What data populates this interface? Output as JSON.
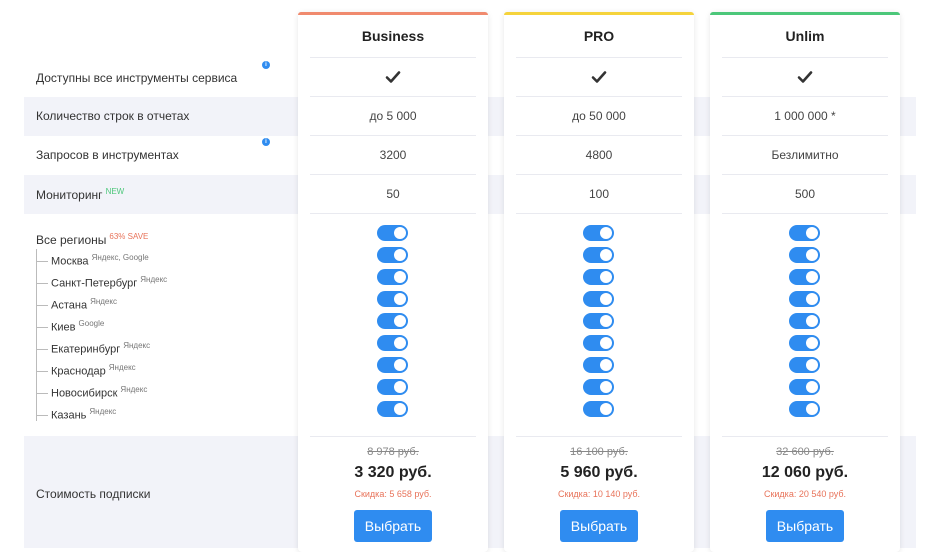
{
  "plans": [
    {
      "name": "Business",
      "accent": "#f08a6e",
      "lines": "до 5 000",
      "requests": "3200",
      "monitoring": "50",
      "old_price": "8 978 руб.",
      "price": "3 320 руб.",
      "discount": "Скидка: 5 658 руб.",
      "button": "Выбрать"
    },
    {
      "name": "PRO",
      "accent": "#f5d33c",
      "lines": "до 50 000",
      "requests": "4800",
      "monitoring": "100",
      "old_price": "16 100 руб.",
      "price": "5 960 руб.",
      "discount": "Скидка: 10 140 руб.",
      "button": "Выбрать"
    },
    {
      "name": "Unlim",
      "accent": "#4cc77a",
      "lines": "1 000 000 *",
      "requests": "Безлимитно",
      "monitoring": "500",
      "old_price": "32 600 руб.",
      "price": "12 060 руб.",
      "discount": "Скидка: 20 540 руб.",
      "button": "Выбрать"
    }
  ],
  "features": {
    "all_tools": "Доступны все инструменты сервиса",
    "lines": "Количество строк в отчетах",
    "requests": "Запросов в инструментах",
    "monitoring": "Мониторинг",
    "monitoring_badge": "NEW",
    "regions": "Все регионы",
    "regions_badge": "63% SAVE",
    "price": "Стоимость подписки"
  },
  "regions": [
    {
      "name": "Москва",
      "src": "Яндекс, Google"
    },
    {
      "name": "Санкт-Петербург",
      "src": "Яндекс"
    },
    {
      "name": "Астана",
      "src": "Яндекс"
    },
    {
      "name": "Киев",
      "src": "Google"
    },
    {
      "name": "Екатеринбург",
      "src": "Яндекс"
    },
    {
      "name": "Краснодар",
      "src": "Яндекс"
    },
    {
      "name": "Новосибирск",
      "src": "Яндекс"
    },
    {
      "name": "Казань",
      "src": "Яндекс"
    }
  ],
  "icons": {
    "check": "check-icon",
    "info": "info-icon",
    "toggle": "toggle-on"
  },
  "toggle_color": "#2f8cf0"
}
